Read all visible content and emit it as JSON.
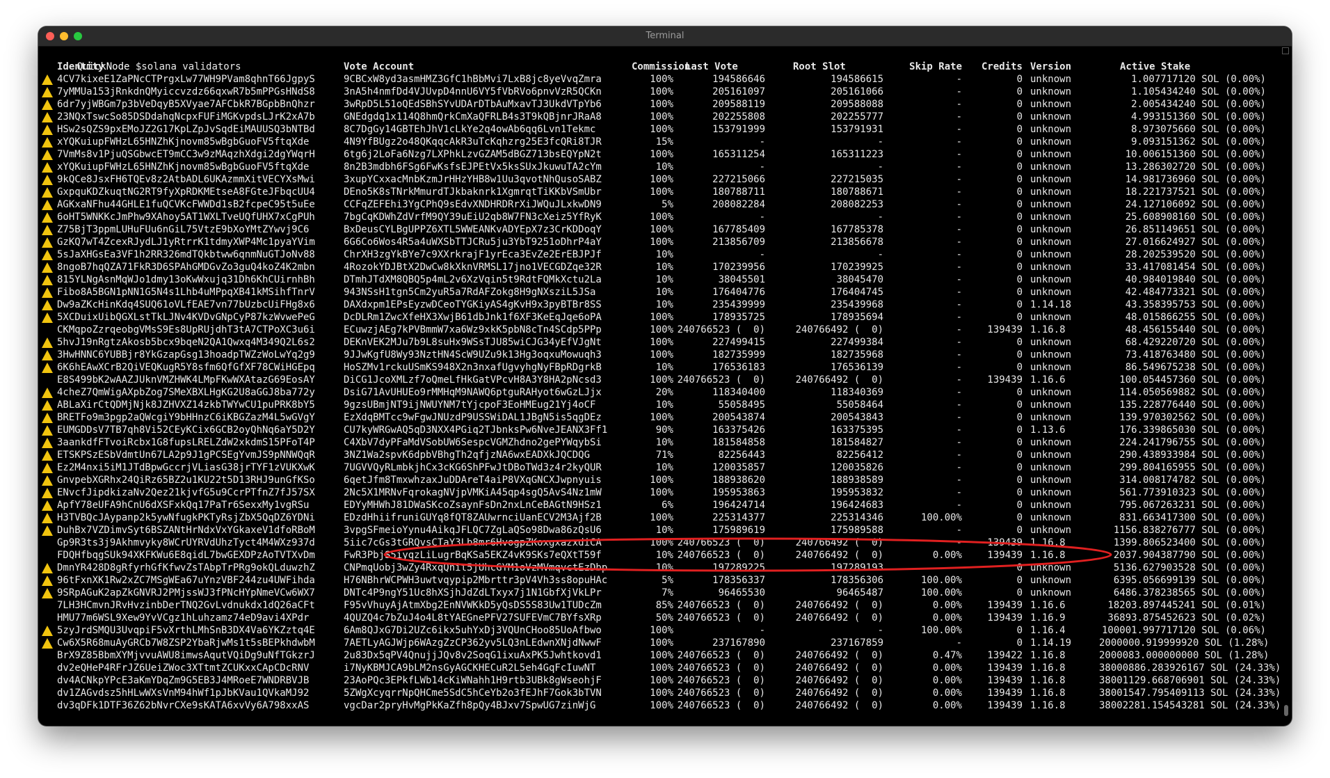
{
  "window": {
    "title": "Terminal"
  },
  "prompt": {
    "host": "QuickNode",
    "command": "$solana validators"
  },
  "colors": {
    "warning": "#f1c40f",
    "annotation": "#e02020",
    "background": "#000000",
    "text": "#e8e8e8"
  },
  "headers": {
    "identity": "Identity",
    "vote": "Vote Account",
    "commission": "Commission",
    "last_vote": "Last Vote",
    "root_slot": "Root Slot",
    "skip_rate": "Skip Rate",
    "credits": "Credits",
    "version": "Version",
    "active_stake": "Active Stake"
  },
  "rows": [
    {
      "w": true,
      "id": "4CV7kixeE1ZaPNcCTPrgxLw77WH9PVam8qhnT66JgpyS",
      "vote": "9CBCxW8yd3asmHMZ3GfC1hBbMvi7LxB8jc8yeVvqZmra",
      "comm": "100%",
      "lv": "194586646",
      "rs": "194586615",
      "sr": "-",
      "cr": "0",
      "ver": "unknown",
      "stake": "1.007717120 SOL (0.00%)"
    },
    {
      "w": true,
      "id": "7yMMUa153jRnkdnQMyiccvzdz66qxwR7b5mPPGsHNdS8",
      "vote": "3nA5h4nmfDd4VJUvpD4nnU6VY5fVbRVo6pnvVzR5QCKn",
      "comm": "100%",
      "lv": "205161097",
      "rs": "205161066",
      "sr": "-",
      "cr": "0",
      "ver": "unknown",
      "stake": "1.105434240 SOL (0.00%)"
    },
    {
      "w": true,
      "id": "6dr7yjWBGm7p3bVeDqyB5XVyae7AFCbkR7BGpbBnQhzr",
      "vote": "3wRpD5L51oQEdSBhSYvUDArDTbAuMxavTJ3UkdVTpYb6",
      "comm": "100%",
      "lv": "209588119",
      "rs": "209588088",
      "sr": "-",
      "cr": "0",
      "ver": "unknown",
      "stake": "2.005434240 SOL (0.00%)"
    },
    {
      "w": true,
      "id": "23NQxTswcSo85DSDdahqNcpxFUFiMGKvpdsLJrK2xA7b",
      "vote": "GNEdgdq1x114Q8hmQrkCmXaQFRLB4s3T9kQBjnrJRaA8",
      "comm": "100%",
      "lv": "202255808",
      "rs": "202255777",
      "sr": "-",
      "cr": "0",
      "ver": "unknown",
      "stake": "4.993151360 SOL (0.00%)"
    },
    {
      "w": true,
      "id": "HSw2sQZS9pxEMoJZ2G17KpLZpJvSqdEiMAUUSQ3bNTBd",
      "vote": "8C7DgGy14GBTEhJhV1cLkYe2q4owAb6qq6Lvn1Tekmc",
      "comm": "100%",
      "lv": "153791999",
      "rs": "153791931",
      "sr": "-",
      "cr": "0",
      "ver": "unknown",
      "stake": "8.973075660 SOL (0.00%)"
    },
    {
      "w": true,
      "id": "xYQKuiupFWHzL65HNZhKjnovm85wBgbGuoFV5ftqXde",
      "vote": "4N9YfBUgz2o48QKqqcAkR3uTcKqhzrg25E3fcQRi8TJR",
      "comm": "15%",
      "lv": "-",
      "rs": "-",
      "sr": "-",
      "cr": "0",
      "ver": "unknown",
      "stake": "9.093151362 SOL (0.00%)"
    },
    {
      "w": true,
      "id": "7VmMs8v1PjuQSGbwcET9mCC3w9zMAqzhXdgi2dgYWqrH",
      "vote": "6tg6j2LoFa6Nzg7LXPhkLzvGZAM5dBGZ713bsEQYpN2t",
      "comm": "100%",
      "lv": "165311254",
      "rs": "165311223",
      "sr": "-",
      "cr": "0",
      "ver": "unknown",
      "stake": "10.006151360 SOL (0.00%)"
    },
    {
      "w": true,
      "id": "xYQKuiupFWHzL65HNZhKjnovm85wBgbGuoFV5ftqXde",
      "vote": "8n2B3mdbh6FSg6FwKsfsEJPEtVx5ksSUxJkuwuTA2cYm",
      "comm": "10%",
      "lv": "-",
      "rs": "-",
      "sr": "-",
      "cr": "0",
      "ver": "unknown",
      "stake": "13.286302720 SOL (0.00%)"
    },
    {
      "w": true,
      "id": "9kQCe8JsxFH6TQEv8z2AtbADL6UKAzmmXitVECYXsMwi",
      "vote": "3xupYCxxacMnbKzmJrHHzYHB8w1Uu3qvotNhQusoSABZ",
      "comm": "100%",
      "lv": "227215066",
      "rs": "227215035",
      "sr": "-",
      "cr": "0",
      "ver": "unknown",
      "stake": "14.981736960 SOL (0.00%)"
    },
    {
      "w": true,
      "id": "GxpquKDZkuqtNG2RT9fyXpRDKMEtseA8FGteJFbqcUU4",
      "vote": "DEno5K8sTNrkMmurdTJkbaknrk1XgmrqtTiKKbVSmUbr",
      "comm": "100%",
      "lv": "180788711",
      "rs": "180788671",
      "sr": "-",
      "cr": "0",
      "ver": "unknown",
      "stake": "18.221737521 SOL (0.00%)"
    },
    {
      "w": true,
      "id": "AGKxaNFhu44GHLE1fuQCVKcFWWDd1sB2fcpeC95t5uEe",
      "vote": "CCFqZEFEhi3YgCPhQ9sEdvXNDHRDRrXiJWQuJLxkwDN9",
      "comm": "5%",
      "lv": "208082284",
      "rs": "208082253",
      "sr": "-",
      "cr": "0",
      "ver": "unknown",
      "stake": "24.127106092 SOL (0.00%)"
    },
    {
      "w": true,
      "id": "6oHT5WNKKcJmPhw9XAhoy5AT1WXLTveUQfUHX7xCgPUh",
      "vote": "7bgCqKDWhZdVrfM9QY39uEiU2qb8W7FN3cXeiz5YfRyK",
      "comm": "100%",
      "lv": "-",
      "rs": "-",
      "sr": "-",
      "cr": "0",
      "ver": "unknown",
      "stake": "25.608908160 SOL (0.00%)"
    },
    {
      "w": true,
      "id": "Z75BjT3ppmLUHuFUu6nGiL75VtzE9bXoYMtZYwvj9C6",
      "vote": "BxDeusCYLBgUPPZ6XTL5WWEANKvADYEpX7z3CrKDDoqY",
      "comm": "100%",
      "lv": "167785409",
      "rs": "167785378",
      "sr": "-",
      "cr": "0",
      "ver": "unknown",
      "stake": "26.851149651 SOL (0.00%)"
    },
    {
      "w": true,
      "id": "GzKQ7wT4ZcexRJydLJ1yRtrrK1tdmyXWP4Mc1pyaYVim",
      "vote": "6G6Co6Wos4R5a4uWXSbTTJCRu5ju3YbT9251oDhrP4aY",
      "comm": "100%",
      "lv": "213856709",
      "rs": "213856678",
      "sr": "-",
      "cr": "0",
      "ver": "unknown",
      "stake": "27.016624927 SOL (0.00%)"
    },
    {
      "w": true,
      "id": "5sJaXHGsEa3VF1h2RR326mdTQkbtww6qnmNuGTJoNv88",
      "vote": "ChrXH3zgYkBYe7c9XXrkrajF1yrEca3EvZe2ErEBJPJf",
      "comm": "10%",
      "lv": "-",
      "rs": "-",
      "sr": "-",
      "cr": "0",
      "ver": "unknown",
      "stake": "28.202539520 SOL (0.00%)"
    },
    {
      "w": true,
      "id": "8ngoB7hqQZA71FkR3D6SPAhGMDGvZo3guQ4koZ4K2mbn",
      "vote": "4RozokYDJBtX2DwCw8kXknVRMSL17jno1VECGDZqe32R",
      "comm": "10%",
      "lv": "170239956",
      "rs": "170239925",
      "sr": "-",
      "cr": "0",
      "ver": "unknown",
      "stake": "33.417081454 SOL (0.00%)"
    },
    {
      "w": true,
      "id": "815YLNgAsnMqWJo1dmy13oKwWxujq31Dh6KhCUirnhBh",
      "vote": "DTmhJTdXM8QBQ5p4mL2v6XzVqin5t9RdtFQMkXctu2La",
      "comm": "10%",
      "lv": "38045501",
      "rs": "38045470",
      "sr": "-",
      "cr": "0",
      "ver": "unknown",
      "stake": "40.984019840 SOL (0.00%)"
    },
    {
      "w": true,
      "id": "Fibo8A5BGN1pNN1G5N4s1Lhb4uMPpqXB41kMSihfTnrV",
      "vote": "943NSsH1tgn5Cm2yuR5a7RdAFZokg8H9gNXsziL5JSa",
      "comm": "10%",
      "lv": "176404776",
      "rs": "176404745",
      "sr": "-",
      "cr": "0",
      "ver": "unknown",
      "stake": "42.484773321 SOL (0.00%)"
    },
    {
      "w": true,
      "id": "Dw9aZKcHinKdq4SUQ61oVLfEAE7vn77bUzbcUiFHg8x6",
      "vote": "DAXdxpm1EPsEyzwDCeoTYGKiyAS4gKvH9x3pyBTBr8SS",
      "comm": "10%",
      "lv": "235439999",
      "rs": "235439968",
      "sr": "-",
      "cr": "0",
      "ver": "1.14.18",
      "stake": "43.358395753 SOL (0.00%)"
    },
    {
      "w": true,
      "id": "5XCDuixUibQGXLstTkLJNv4KVDvGNpCyP87kzWvwePeG",
      "vote": "DcDLRm1ZwcXfeHX3XwjB61dbJnk1f6XF3KeEqJqe6oPA",
      "comm": "100%",
      "lv": "178935725",
      "rs": "178935694",
      "sr": "-",
      "cr": "0",
      "ver": "unknown",
      "stake": "48.015866255 SOL (0.00%)"
    },
    {
      "w": false,
      "id": "CKMqpoZzrqeobgVMsS9Es8UpRUjdhT3tA7CTPoXC3u6i",
      "vote": "ECuwzjAEg7kPVBmmW7xa6Wz9xkK5pbN8cTn4SCdp5PPp",
      "comm": "100%",
      "lv": "240766523 (  0)",
      "rs": "240766492 (  0)",
      "sr": "-",
      "cr": "139439",
      "ver": "1.16.8",
      "stake": "48.456155440 SOL (0.00%)"
    },
    {
      "w": true,
      "id": "5hvJ19nRgtzAkosb5bcx9bqeN2QA1Qwxq4M349Q2L6s2",
      "vote": "DEKnVEK2MJu7b9L8suHx9WSsTJU85wiCJG34yEfVJgNt",
      "comm": "100%",
      "lv": "227499415",
      "rs": "227499384",
      "sr": "-",
      "cr": "0",
      "ver": "unknown",
      "stake": "68.429220720 SOL (0.00%)"
    },
    {
      "w": true,
      "id": "3HwHNNC6YUBBjr8YkGzapGsg13hoadpTWZzWoLwYq2g9",
      "vote": "9JJwKgfU8Wy93NztHN4ScW9UZu9k13Hg3oqxuMowuqh3",
      "comm": "100%",
      "lv": "182735999",
      "rs": "182735968",
      "sr": "-",
      "cr": "0",
      "ver": "unknown",
      "stake": "73.418763480 SOL (0.00%)"
    },
    {
      "w": true,
      "id": "6K6hEAwXCrB2QiVEQKugR5Y8sfm6QfGfXF78CWiHGEpq",
      "vote": "HoSZMv1rckuUSmKS948X2n3nxafUgvyhgNyFBpRDgrkB",
      "comm": "10%",
      "lv": "176536183",
      "rs": "176536139",
      "sr": "-",
      "cr": "0",
      "ver": "unknown",
      "stake": "86.549675238 SOL (0.00%)"
    },
    {
      "w": false,
      "id": "E8S499bK2wAAZJUknVMZHWK4LMpFKwWXAtazG69EosAY",
      "vote": "DiCG1JcoXMLzf7oQmeLfHkGatVPcvH8A3Y8HA2pNcsd3",
      "comm": "100%",
      "lv": "240766523 (  0)",
      "rs": "240766492 (  0)",
      "sr": "-",
      "cr": "139439",
      "ver": "1.16.6",
      "stake": "100.054457360 SOL (0.00%)"
    },
    {
      "w": true,
      "id": "4cheZ7QmWigAXpbZog7SMeXBXLHgKG2U8aGGJ8ba772y",
      "vote": "DsiG71AvUHUEo9rMMHqM9NAWQ6ptguRAHyot6wGzLJjx",
      "comm": "20%",
      "lv": "118340400",
      "rs": "118340369",
      "sr": "-",
      "cr": "0",
      "ver": "unknown",
      "stake": "114.050569882 SOL (0.00%)"
    },
    {
      "w": true,
      "id": "ABLaXirCtQDMjNjk8JZHVXZ14zkbTWYwCU1puPRK8bY5",
      "vote": "9gzsUBmjNT9ijNWUYNM7tYjcpoF3EoHMEug21Yj4oCF",
      "comm": "10%",
      "lv": "55058495",
      "rs": "55058464",
      "sr": "-",
      "cr": "0",
      "ver": "unknown",
      "stake": "135.228776440 SOL (0.00%)"
    },
    {
      "w": true,
      "id": "BRETFo9m3pgp2aQWcgiY9bHHnzC6iKBGZazM4L5wGVgY",
      "vote": "EzXdqBMTcc9wFgwJNUzdP9USSWiDAL1JBgN5is5qgDEz",
      "comm": "100%",
      "lv": "200543874",
      "rs": "200543843",
      "sr": "-",
      "cr": "0",
      "ver": "unknown",
      "stake": "139.970302562 SOL (0.00%)"
    },
    {
      "w": true,
      "id": "EUMGDDsV7TB7qh8Vi52CEyKCix6GCB2oyQhNq6aY5D2Y",
      "vote": "CU7kyWRGwAQ5qD3NXX4PGiq2TJbnksPw6NveJEANX3Ff1",
      "comm": "90%",
      "lv": "163375426",
      "rs": "163375395",
      "sr": "-",
      "cr": "0",
      "ver": "1.13.6",
      "stake": "176.339865030 SOL (0.00%)"
    },
    {
      "w": true,
      "id": "3aankdfFTvoiRcbx1G8fupsLRELZdW2xkdmS15PFoT4P",
      "vote": "C4XbV7dyPFaMdVSobUW6SespcVGMZhdno2gePYWqybSi",
      "comm": "10%",
      "lv": "181584858",
      "rs": "181584827",
      "sr": "-",
      "cr": "0",
      "ver": "unknown",
      "stake": "224.241796755 SOL (0.00%)"
    },
    {
      "w": true,
      "id": "ETSKPSzESbVdmtUn67LA2p9J1gPCSEgYvmJS9pNNWQqR",
      "vote": "3NZ1Wa2spvK6dpbVBhgTh2qfjzNA6wxEADXkJQCDQG",
      "comm": "71%",
      "lv": "82256443",
      "rs": "82256412",
      "sr": "-",
      "cr": "0",
      "ver": "unknown",
      "stake": "290.438933984 SOL (0.00%)"
    },
    {
      "w": true,
      "id": "Ez2M4nxi5iM1JTdBpwGccrjVLiasG38jrTYF1zVUKXwK",
      "vote": "7UGVVQyRLmbkjhCx3cKG6ShPFwJtDBoTWd3z4r2kyQUR",
      "comm": "10%",
      "lv": "120035857",
      "rs": "120035826",
      "sr": "-",
      "cr": "0",
      "ver": "unknown",
      "stake": "299.804165955 SOL (0.00%)"
    },
    {
      "w": true,
      "id": "GnvpebXGRhx24QiRz65BZ2u1KU22t5D13RHJ9unGfKSo",
      "vote": "6qetJfm8TmxwhzaxJuDDAreT4aiP8VXqGNCXJwpnyuis",
      "comm": "100%",
      "lv": "188938620",
      "rs": "188938589",
      "sr": "-",
      "cr": "0",
      "ver": "unknown",
      "stake": "314.008174782 SOL (0.00%)"
    },
    {
      "w": true,
      "id": "ENvcfJipdkizaNv2Qez21kjvfG5u9CcrPTfnZ7fJ57SX",
      "vote": "2Nc5X1MRNvFqrokagNVjpVMKiA45qp4sgQ5AvS4Nz1mW",
      "comm": "100%",
      "lv": "195953863",
      "rs": "195953832",
      "sr": "-",
      "cr": "0",
      "ver": "unknown",
      "stake": "561.773910323 SOL (0.00%)"
    },
    {
      "w": true,
      "id": "ApfY78eUFA9hCnU6dXSFxkQq17PaTr6SexxMy1vgRSu",
      "vote": "EDYyMHWhJ81DWaSKcoZsaynFsDn2nxLnCeBAGtN9HSz1",
      "comm": "6%",
      "lv": "196424714",
      "rs": "196424683",
      "sr": "-",
      "cr": "0",
      "ver": "unknown",
      "stake": "795.067263231 SOL (0.00%)"
    },
    {
      "w": true,
      "id": "H3TVBQcJAypanp2k5ywNfugkPKTyRsjZbX5QqDZ6YDNi",
      "vote": "EDzdHhiifruniGUYq8fQT8ZAUwrnciUanECV2M3Ajf2B",
      "comm": "100%",
      "lv": "225314377",
      "rs": "225314346",
      "sr": "100.00%",
      "cr": "0",
      "ver": "unknown",
      "stake": "831.663417300 SOL (0.00%)"
    },
    {
      "w": true,
      "id": "DuhBx7VZDimvSyt6BSZANtHrNdxVxYGkaxeV1dfoRBoM",
      "vote": "3vpgSFmeioYynu4AikqJFLQC7ZgLaQSo98Dwa86zQsU6",
      "comm": "10%",
      "lv": "175989619",
      "rs": "175989588",
      "sr": "-",
      "cr": "0",
      "ver": "unknown",
      "stake": "1156.838276777 SOL (0.00%)"
    },
    {
      "w": false,
      "id": "Gp9R3ts3j9Akhmvyky8WCrUYRVdUhzTyct4M4WXz937d",
      "vote": "5iic7cGs3tGRQvsCTaY3Lb8mr6HvogpZKoxgxazxdiCA",
      "comm": "100%",
      "lv": "240766523 (  0)",
      "rs": "240766492 (  0)",
      "sr": "-",
      "cr": "139439",
      "ver": "1.16.8",
      "stake": "1399.806523400 SOL (0.00%)"
    },
    {
      "w": false,
      "id": "FDQHfbqgSUk94XKFKWu6E8qidL7bwGEXDPzAoTVTXvDm",
      "vote": "FwR3PbjS5iyqzLiLugrBqKSa5EKZ4vK9SKs7eQXtT59f",
      "comm": "10%",
      "lv": "240766523 (  0)",
      "rs": "240766492 (  0)",
      "sr": "0.00%",
      "cr": "139439",
      "ver": "1.16.8",
      "stake": "2037.904387790 SOL (0.00%)"
    },
    {
      "w": true,
      "id": "DmnYR428D8gRfyrhGfKfwvZsTAbpTrPRg9okQLduwzhZ",
      "vote": "CNPmqUobj3wZy4RxqQnit5jUhcGYM1oVzMVmqvctEzDbp",
      "comm": "10%",
      "lv": "197289225",
      "rs": "197289193",
      "sr": "-",
      "cr": "0",
      "ver": "unknown",
      "stake": "5136.627903528 SOL (0.00%)"
    },
    {
      "w": true,
      "id": "96tFxnXK1Rw2xZC7MSgWEa67uYnzVBF244zu4UWFihda",
      "vote": "H76NBhrWCPWH3uwtvqypip2Mbrttr3pV4Vh3ss8opuHAc",
      "comm": "5%",
      "lv": "178356337",
      "rs": "178356306",
      "sr": "100.00%",
      "cr": "0",
      "ver": "unknown",
      "stake": "6395.056699139 SOL (0.00%)"
    },
    {
      "w": true,
      "id": "9SRpAGuK2apZkGNVRJ2PMjssWJ3fPNcHYpNmeVCw6WX7",
      "vote": "DNTc4P9ngY51Uc8hXSjhJdZdLTxyx7j1N1GbfXjVkLPr",
      "comm": "7%",
      "lv": "96465530",
      "rs": "96465487",
      "sr": "100.00%",
      "cr": "0",
      "ver": "unknown",
      "stake": "6486.378238565 SOL (0.00%)"
    },
    {
      "w": false,
      "id": "7LH3HCmvnJRvHvzinbDerTNQ2GvLvdnukdx1dQ26aCFt",
      "vote": "F95vVhuyAjAtmXbg2EnNVWKkD5yQsDS5S83Uw1TUDcZm",
      "comm": "85%",
      "lv": "240766523 (  0)",
      "rs": "240766492 (  0)",
      "sr": "0.00%",
      "cr": "139439",
      "ver": "1.16.6",
      "stake": "18203.897445241 SOL (0.01%)"
    },
    {
      "w": false,
      "id": "HMU77m6WSL9Xew9YvVCgz1hLuhzamz74eD9avi4XPdr",
      "vote": "4QUZQ4c7bZuJ4o4L8tYAEGnePFV27SUFEVmC7BYfsXRp",
      "comm": "50%",
      "lv": "240766523 (  0)",
      "rs": "240766492 (  0)",
      "sr": "0.00%",
      "cr": "139439",
      "ver": "1.16.9",
      "stake": "36893.875452623 SOL (0.02%)"
    },
    {
      "w": true,
      "id": "5zyJrdSMQU3UvqpiF5vXrthLMhSnB3DX4Va6YKZztq4E",
      "vote": "6Am8QJxG7Di2UZc6ikx5uhYxDj3VQUnCHoo85UoAfbwo",
      "comm": "100%",
      "lv": "-",
      "rs": "-",
      "sr": "100.00%",
      "cr": "0",
      "ver": "1.16.4",
      "stake": "100001.997717120 SOL (0.06%)"
    },
    {
      "w": true,
      "id": "Cw6X5R68muAyGRCb7W8ZSP2YbaRjwMs1t5sBEPkhdwbM",
      "vote": "7AETLyAGJWjp6WAzgZzCP362yv5LQ3nLEdwnXNjdNwwF",
      "comm": "100%",
      "lv": "237167890",
      "rs": "237167859",
      "sr": "-",
      "cr": "0",
      "ver": "1.14.19",
      "stake": "2000000.919999920 SOL (1.28%)"
    },
    {
      "w": false,
      "id": "BrX9Z85BbmXYMjvvuAWU8imwsAqutVQiDg9uNfTGkzrJ",
      "vote": "2u83Dx5qPV4QnujjJQv8v2SoqG1ixuAxPK5Jwhtkovd1",
      "comm": "100%",
      "lv": "240766523 (  0)",
      "rs": "240766492 (  0)",
      "sr": "0.47%",
      "cr": "139422",
      "ver": "1.16.8",
      "stake": "2000083.000000000 SOL (1.28%)"
    },
    {
      "w": false,
      "id": "dv2eQHeP4RFrJZ6UeiZWoc3XTtmtZCUKxxCApCDcRNV",
      "vote": "i7NyKBMJCA9bLM2nsGyAGCKHECuR2L5eh4GqFcIuwNT",
      "comm": "100%",
      "lv": "240766523 (  0)",
      "rs": "240766492 (  0)",
      "sr": "0.00%",
      "cr": "139439",
      "ver": "1.16.8",
      "stake": "38000886.283926167 SOL (24.33%)"
    },
    {
      "w": false,
      "id": "dv4ACNkpYPcE3aKmYDqZm9G5EB3J4MRoeE7WNDRBVJB",
      "vote": "23AoPQc3EPkfLWb14cKiWNahh1H9rtb3UBk8gWseohjF",
      "comm": "100%",
      "lv": "240766523 (  0)",
      "rs": "240766492 (  0)",
      "sr": "0.00%",
      "cr": "139439",
      "ver": "1.16.8",
      "stake": "38001129.668706901 SOL (24.33%)"
    },
    {
      "w": false,
      "id": "dv1ZAGvdsz5hHLwWXsVnM94hWf1pJbKVau1QVkaMJ92",
      "vote": "5ZWgXcyqrrNpQHCme5SdC5hCeYb2o3fEJhF7Gok3bTVN",
      "comm": "100%",
      "lv": "240766523 (  0)",
      "rs": "240766492 (  0)",
      "sr": "0.00%",
      "cr": "139439",
      "ver": "1.16.8",
      "stake": "38001547.795409113 SOL (24.33%)"
    },
    {
      "w": false,
      "id": "dv3qDFk1DTF36Z62bNvrCXe9sKATA6xvVy6A798xxAS",
      "vote": "vgcDar2pryHvMgPkKaZfh8pQy4BJxv7SpwUG7zinWjG",
      "comm": "100%",
      "lv": "240766523 (  0)",
      "rs": "240766492 (  0)",
      "sr": "0.00%",
      "cr": "139439",
      "ver": "1.16.8",
      "stake": "38002281.154543281 SOL (24.33%)"
    }
  ]
}
